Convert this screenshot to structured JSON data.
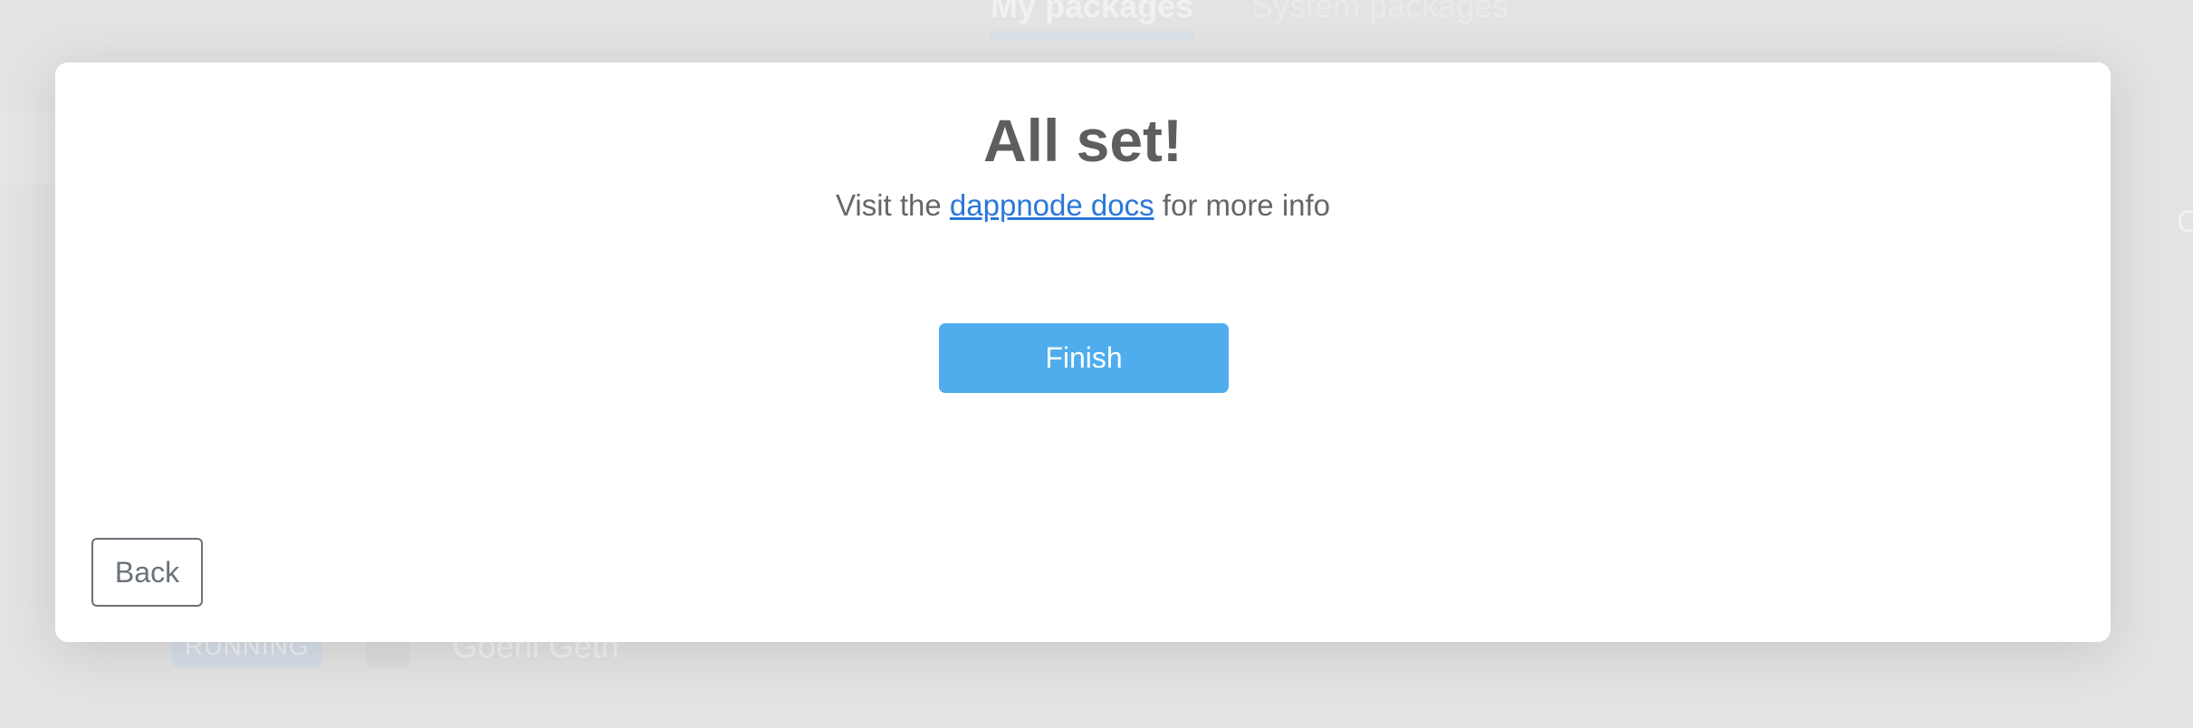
{
  "background": {
    "tabs": [
      {
        "label": "My packages",
        "active": true
      },
      {
        "label": "System packages",
        "active": false
      }
    ],
    "package_row": {
      "status": "RUNNING",
      "name": "Goerli Geth"
    },
    "right_glyph": "C"
  },
  "modal": {
    "title": "All set!",
    "subtitle_prefix": "Visit the",
    "docs_link_label": "dappnode docs",
    "subtitle_suffix": "for more info",
    "finish_label": "Finish",
    "back_label": "Back"
  },
  "colors": {
    "primary_button": "#4fadee",
    "link": "#2b77d9",
    "title_text": "#5e5e5e"
  }
}
